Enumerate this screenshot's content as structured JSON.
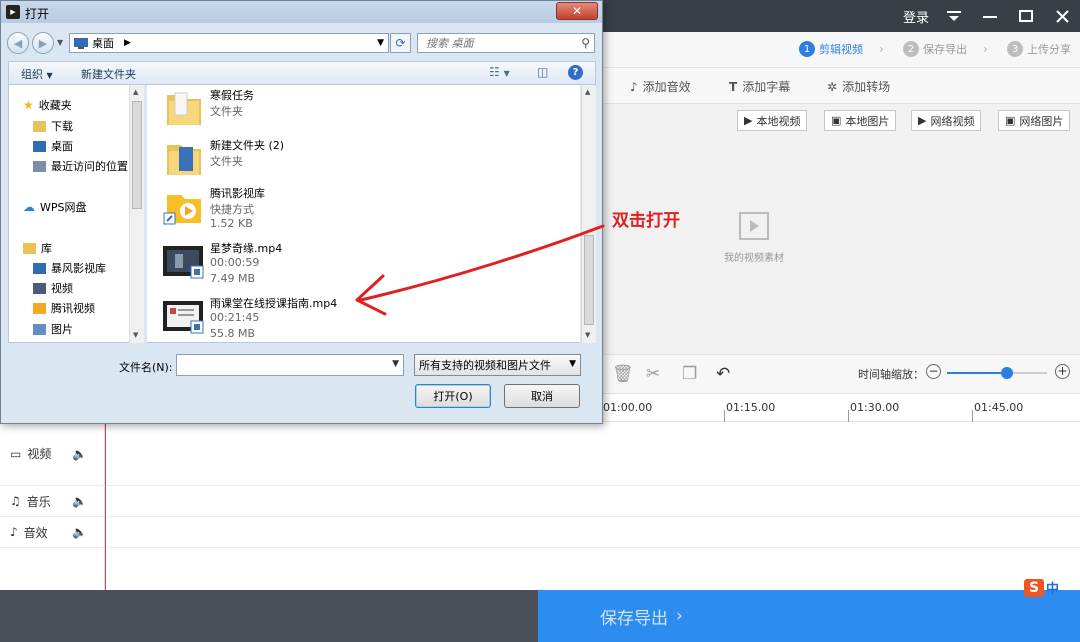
{
  "app": {
    "title_controls": {
      "login": "登录",
      "menu_icon": "menu-icon",
      "minimize_icon": "minimize-icon",
      "maximize_icon": "maximize-icon",
      "close_icon": "close-icon"
    },
    "steps": [
      {
        "num": "1",
        "label": "剪辑视频",
        "active": true
      },
      {
        "num": "2",
        "label": "保存导出",
        "active": false
      },
      {
        "num": "3",
        "label": "上传分享",
        "active": false
      }
    ],
    "tools": [
      {
        "icon": "music-note-icon",
        "label": "添加音效"
      },
      {
        "icon": "text-icon",
        "label": "添加字幕"
      },
      {
        "icon": "transition-icon",
        "label": "添加转场"
      }
    ],
    "media_buttons": [
      "本地视频",
      "本地图片",
      "网络视频",
      "网络图片"
    ],
    "media_empty_label": "我的视频素材",
    "zoom": {
      "label": "时间轴缩放：",
      "minus": "−",
      "plus": "+",
      "level": 0.6
    },
    "ruler_ticks": [
      "01:00.00",
      "01:15.00",
      "01:30.00",
      "01:45.00"
    ],
    "tracks": [
      {
        "icon": "video-camera-icon",
        "label": "视频"
      },
      {
        "icon": "music-icon",
        "label": "音乐"
      },
      {
        "icon": "sound-effect-icon",
        "label": "音效"
      }
    ],
    "save_export": "保存导出",
    "ime": {
      "logo": "S",
      "lang": "中"
    }
  },
  "dialog": {
    "title": "打开",
    "close": "✕",
    "address": "桌面",
    "search_placeholder": "搜索 桌面",
    "commands": {
      "organize": "组织",
      "new_folder": "新建文件夹"
    },
    "help": "?",
    "nav": {
      "favorites": "收藏夹",
      "favorites_items": [
        "下载",
        "桌面",
        "最近访问的位置"
      ],
      "wps": "WPS网盘",
      "library": "库",
      "library_items": [
        "暴风影视库",
        "视频",
        "腾讯视频",
        "图片"
      ]
    },
    "files": [
      {
        "name": "寒假任务",
        "meta1": "文件夹",
        "meta2": "",
        "kind": "folder"
      },
      {
        "name": "新建文件夹 (2)",
        "meta1": "文件夹",
        "meta2": "",
        "kind": "folder"
      },
      {
        "name": "腾讯影视库",
        "meta1": "快捷方式",
        "meta2": "1.52 KB",
        "kind": "shortcut"
      },
      {
        "name": "星梦奇缘.mp4",
        "meta1": "00:00:59",
        "meta2": "7.49 MB",
        "kind": "video"
      },
      {
        "name": "雨课堂在线授课指南.mp4",
        "meta1": "00:21:45",
        "meta2": "55.8 MB",
        "kind": "video"
      }
    ],
    "filename_label": "文件名(N):",
    "filename_value": "",
    "file_type": "所有支持的视频和图片文件",
    "open_button": "打开(O)",
    "cancel_button": "取消"
  },
  "annotation": {
    "text": "双击打开",
    "color": "#e0201f"
  },
  "colors": {
    "accent": "#2d8cf0",
    "titlebar": "#3a3f47"
  }
}
